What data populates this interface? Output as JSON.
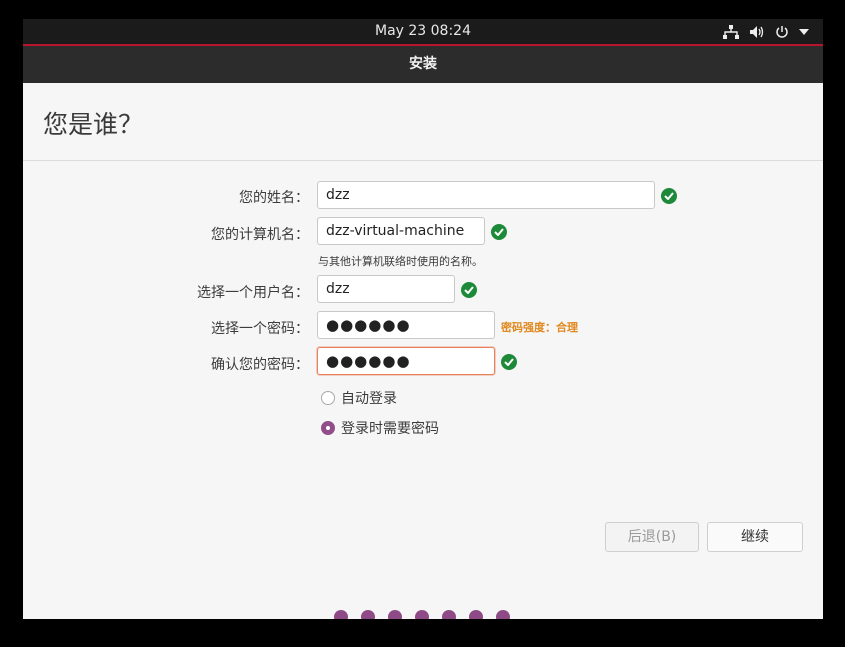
{
  "topbar": {
    "clock": "May 23  08:24",
    "tray_icons": [
      "network-icon",
      "volume-icon",
      "power-icon",
      "dropdown-arrow-icon"
    ]
  },
  "window": {
    "title": "安装"
  },
  "page": {
    "heading": "您是谁？"
  },
  "form": {
    "name_label": "您的姓名：",
    "name_value": "dzz",
    "computer_label": "您的计算机名：",
    "computer_value": "dzz-virtual-machine",
    "computer_hint": "与其他计算机联络时使用的名称。",
    "username_label": "选择一个用户名：",
    "username_value": "dzz",
    "password_label": "选择一个密码：",
    "password_value": "●●●●●●",
    "password_strength": "密码强度：合理",
    "confirm_label": "确认您的密码：",
    "confirm_value": "●●●●●●"
  },
  "login_options": {
    "auto_login": "自动登录",
    "require_password": "登录时需要密码",
    "selected": "require_password"
  },
  "buttons": {
    "back": "后退(B)",
    "continue": "继续"
  },
  "progress": {
    "steps_shown": 7
  },
  "colors": {
    "accent": "#924d8b",
    "check": "#1d8a3a",
    "strength": "#e1881f",
    "focus": "#e9815c"
  }
}
